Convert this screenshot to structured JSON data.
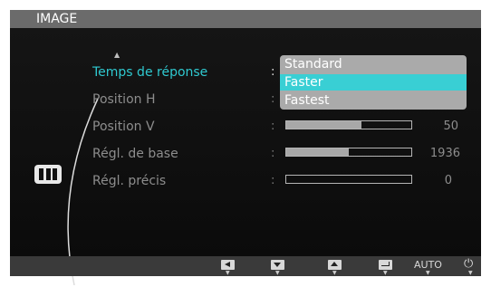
{
  "window": {
    "title": "IMAGE"
  },
  "menu": {
    "items": [
      {
        "label": "Temps de réponse",
        "active": true
      },
      {
        "label": "Position H"
      },
      {
        "label": "Position V",
        "value": "50",
        "level": 0.6
      },
      {
        "label": "Régl. de base",
        "value": "1936",
        "level": 0.5
      },
      {
        "label": "Régl. précis",
        "value": "0",
        "level": 0.0
      }
    ],
    "colon": ":"
  },
  "dropdown": {
    "options": [
      "Standard",
      "Faster",
      "Fastest"
    ],
    "selected": "Faster"
  },
  "footer": {
    "buttons": [
      {
        "name": "left",
        "icon": "left-triangle-icon"
      },
      {
        "name": "down",
        "icon": "down-triangle-icon"
      },
      {
        "name": "up",
        "icon": "up-triangle-icon"
      },
      {
        "name": "enter",
        "icon": "enter-icon"
      },
      {
        "name": "auto",
        "label": "AUTO"
      },
      {
        "name": "power",
        "icon": "power-icon",
        "glyph": "⏻"
      }
    ],
    "pointer_glyph": "▼"
  },
  "colors": {
    "accent": "#2fc9d0",
    "selected_option": "#39cfd4",
    "title_bar": "#6b6b6b",
    "background": "#121212"
  }
}
